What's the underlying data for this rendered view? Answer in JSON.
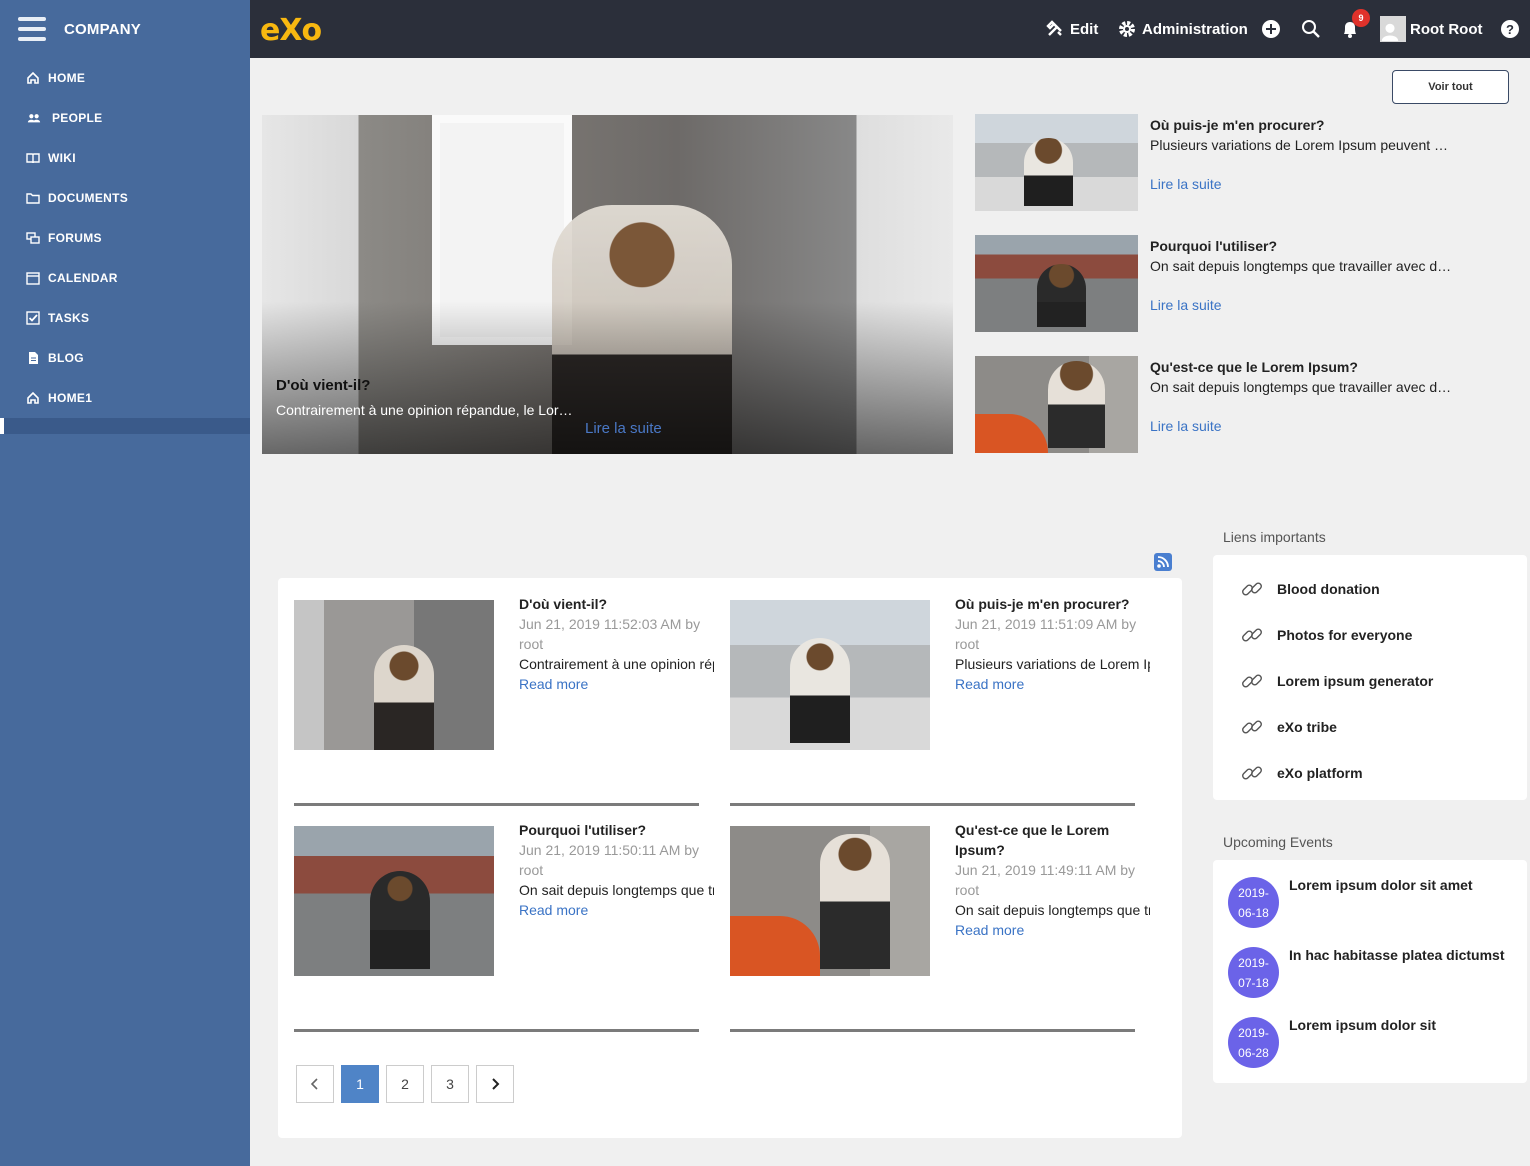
{
  "sidebar": {
    "company": "COMPANY",
    "items": [
      {
        "label": "HOME",
        "icon": "home-icon"
      },
      {
        "label": "PEOPLE",
        "icon": "people-icon"
      },
      {
        "label": "WIKI",
        "icon": "book-icon"
      },
      {
        "label": "DOCUMENTS",
        "icon": "folder-icon"
      },
      {
        "label": "FORUMS",
        "icon": "forum-icon"
      },
      {
        "label": "CALENDAR",
        "icon": "calendar-icon"
      },
      {
        "label": "TASKS",
        "icon": "check-icon"
      },
      {
        "label": "BLOG",
        "icon": "file-icon"
      },
      {
        "label": "HOME1",
        "icon": "home-icon"
      }
    ]
  },
  "topbar": {
    "logo": "eXo",
    "edit": "Edit",
    "administration": "Administration",
    "notifications_count": "9",
    "user": "Root Root"
  },
  "main": {
    "view_all": "Voir tout",
    "hero": {
      "title": "D'où vient-il?",
      "summary": "Contrairement à une opinion répandue, le Lorem Ipsum",
      "more": "Lire la suite"
    },
    "side_news": [
      {
        "title": "Où puis-je m'en procurer?",
        "summary": "Plusieurs variations de Lorem Ipsum peuvent être trouvées",
        "more": "Lire la suite"
      },
      {
        "title": "Pourquoi l'utiliser?",
        "summary": "On sait depuis longtemps que travailler avec du texte lisible",
        "more": "Lire la suite"
      },
      {
        "title": "Qu'est-ce que le Lorem Ipsum?",
        "summary": "On sait depuis longtemps que travailler avec du texte lisible",
        "more": "Lire la suite"
      }
    ],
    "news_list": [
      {
        "title": "D'où vient-il?",
        "date": "Jun 21, 2019 11:52:03 AM by",
        "author": "root",
        "summary": "Contrairement à une opinion répandue",
        "more": "Read more"
      },
      {
        "title": "Où puis-je m'en procurer?",
        "date": "Jun 21, 2019 11:51:09 AM by",
        "author": "root",
        "summary": "Plusieurs variations de Lorem Ipsum",
        "more": "Read more"
      },
      {
        "title": "Pourquoi l'utiliser?",
        "date": "Jun 21, 2019 11:50:11 AM by",
        "author": "root",
        "summary": "On sait depuis longtemps que travailler",
        "more": "Read more"
      },
      {
        "title": "Qu'est-ce que le Lorem Ipsum?",
        "date": "Jun 21, 2019 11:49:11 AM by",
        "author": "root",
        "summary": "On sait depuis longtemps que travailler",
        "more": "Read more"
      }
    ],
    "pagination": {
      "pages": [
        "1",
        "2",
        "3"
      ],
      "current": "1"
    }
  },
  "links_widget": {
    "title": "Liens importants",
    "items": [
      "Blood donation",
      "Photos for everyone",
      "Lorem ipsum generator",
      "eXo tribe",
      "eXo platform"
    ]
  },
  "events_widget": {
    "title": "Upcoming Events",
    "items": [
      {
        "date_year": "2019-",
        "date_md": "06-18",
        "title": "Lorem ipsum dolor sit amet"
      },
      {
        "date_year": "2019-",
        "date_md": "07-18",
        "title": "In hac habitasse platea dictumst"
      },
      {
        "date_year": "2019-",
        "date_md": "06-28",
        "title": "Lorem ipsum dolor sit"
      }
    ]
  },
  "colors": {
    "sidebar": "#476a9c",
    "topbar": "#2b2f3a",
    "logo": "#f8b810",
    "link": "#3a73c5",
    "event": "#6b63e8",
    "badge": "#e0322b"
  }
}
